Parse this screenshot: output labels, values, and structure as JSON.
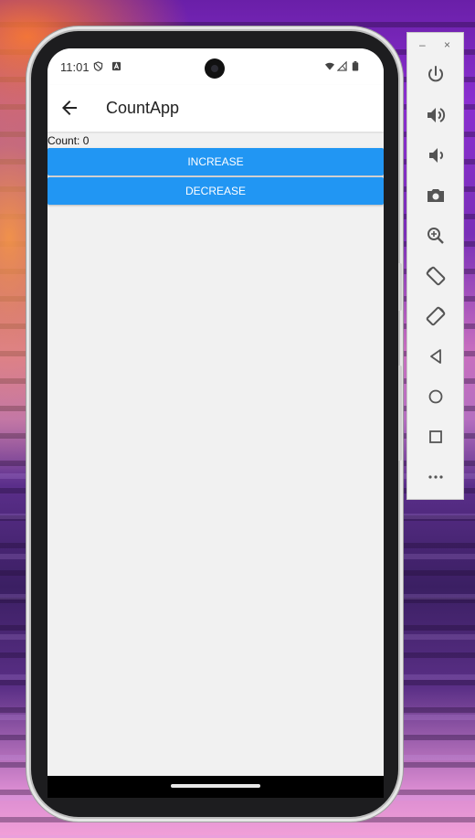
{
  "status_bar": {
    "time": "11:01"
  },
  "app_bar": {
    "title": "CountApp"
  },
  "content": {
    "count_label": "Count: 0",
    "increase_label": "INCREASE",
    "decrease_label": "DECREASE"
  },
  "emulator_toolbar": {
    "minimize_label": "–",
    "close_label": "×",
    "buttons": [
      "power-icon",
      "volume-up-icon",
      "volume-down-icon",
      "camera-icon",
      "zoom-icon",
      "rotate-left-icon",
      "rotate-right-icon",
      "back-icon",
      "home-icon",
      "overview-icon",
      "more-icon"
    ]
  },
  "colors": {
    "accent": "#2196f3",
    "app_bar": "#ffffff",
    "screen_background": "#f1f1f1"
  }
}
